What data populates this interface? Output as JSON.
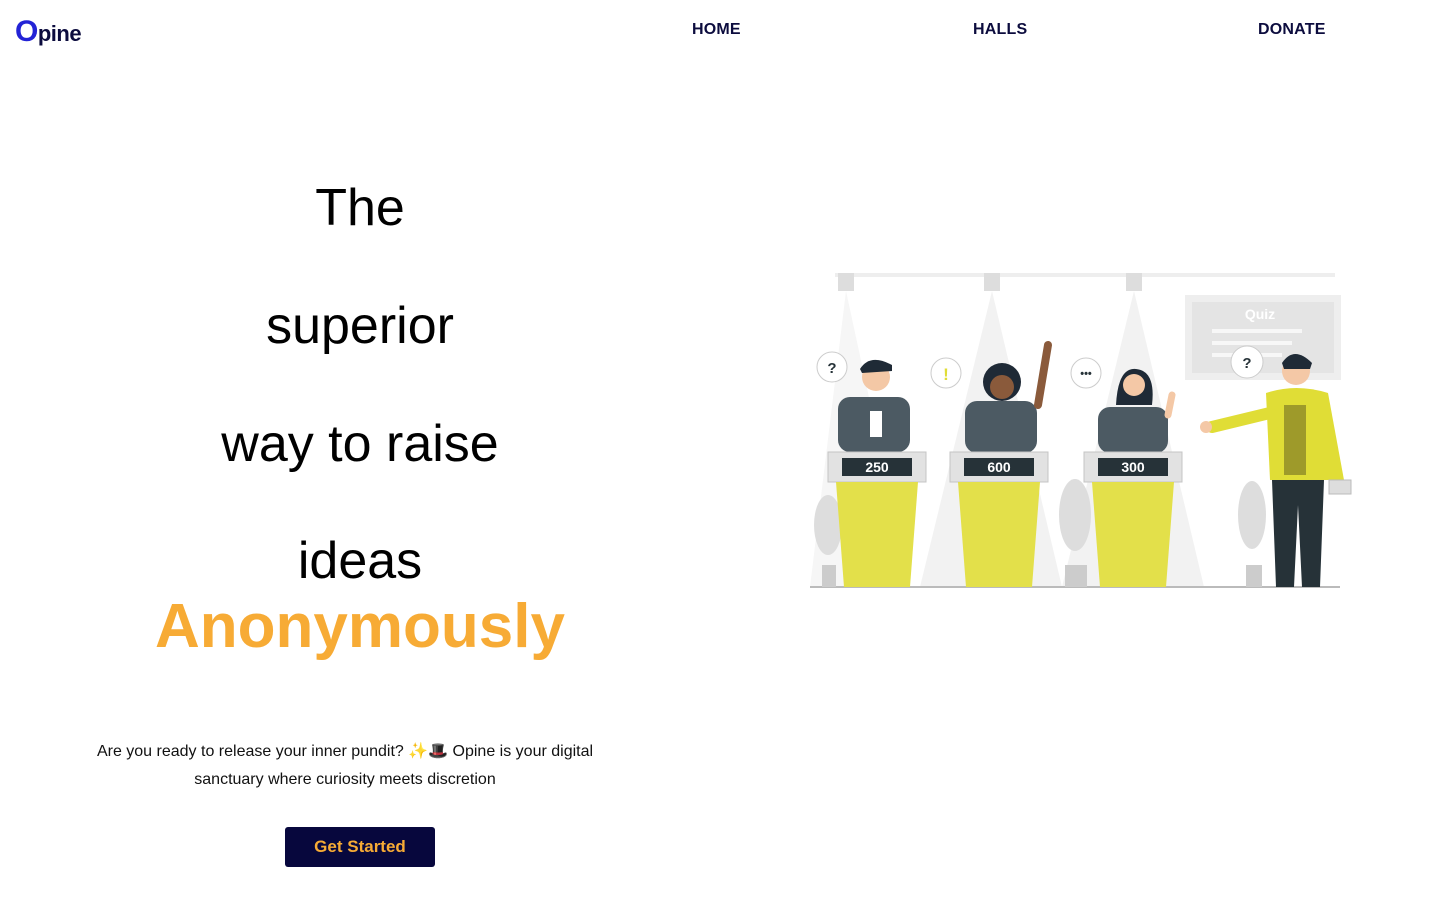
{
  "brand": {
    "logo_initial": "O",
    "logo_rest": "pine"
  },
  "nav": {
    "items": [
      {
        "label": "HOME"
      },
      {
        "label": "HALLS"
      },
      {
        "label": "DONATE"
      }
    ]
  },
  "hero": {
    "lines": [
      "The",
      "superior",
      "way to raise",
      "ideas"
    ],
    "accent": "Anonymously",
    "accent_color": "#f7ab35",
    "subtitle": "Are you ready to release your inner pundit? ✨🎩 Opine is your digital sanctuary where curiosity meets discretion",
    "cta_label": "Get Started",
    "cta_bg": "#07073d"
  },
  "illustration": {
    "screen_label": "Quiz",
    "scores": [
      "250",
      "600",
      "300"
    ],
    "bubbles": [
      "?",
      "!",
      "•••",
      "?"
    ],
    "podium_color": "#e3e04a"
  }
}
